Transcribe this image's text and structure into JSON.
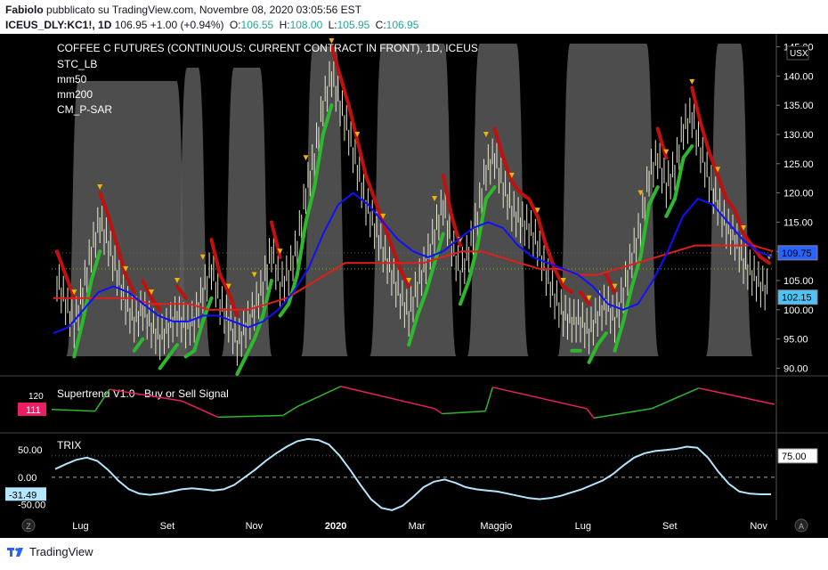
{
  "header": {
    "author": "Fabiolo",
    "published_text": "pubblicato su TradingView.com, Novembre 08, 2020 03:05:56 EST",
    "symbol": "ICEUS_DLY:KC1!, 1D",
    "last": "106.95",
    "change": "+1.00 (+0.94%)",
    "open_label": "O:",
    "open": "106.55",
    "high_label": "H:",
    "high": "108.00",
    "low_label": "L:",
    "low": "105.95",
    "close_label": "C:",
    "close": "106.95"
  },
  "footer": {
    "brand": "TradingView"
  },
  "chart_data": [
    {
      "type": "line",
      "title": "COFFEE C FUTURES (CONTINUOUS: CURRENT CONTRACT IN FRONT), 1D, ICEUS",
      "indicators": [
        "STC_LB",
        "mm50",
        "mm200",
        "CM_P-SAR"
      ],
      "currency": "USX",
      "x_ticks": [
        "Lug",
        "Set",
        "Nov",
        "2020",
        "Mar",
        "Maggio",
        "Lug",
        "Set",
        "Nov"
      ],
      "y_ticks": [
        90,
        95,
        100,
        105,
        110,
        115,
        120,
        125,
        130,
        135,
        140,
        145
      ],
      "ylim": [
        89,
        146
      ],
      "price_labels": [
        {
          "value": 75.0,
          "text": "75.00",
          "color": "#ffffff"
        },
        {
          "value": 109.75,
          "text": "109.75",
          "color": "#2962ff"
        },
        {
          "value": 102.15,
          "text": "102.15",
          "color": "#4fc3f7"
        }
      ],
      "colors": {
        "mm50": "#1010ff",
        "mm200": "#e0201a",
        "trend_up": "#2eb82e",
        "trend_down": "#c0110f",
        "sar": "#f0b400",
        "stc": "#5a5a5a"
      },
      "series": [
        {
          "name": "price",
          "values": [
            105,
            101,
            97,
            103,
            110,
            115,
            111,
            106,
            101,
            98,
            100,
            97,
            95,
            97,
            99,
            97,
            98,
            103,
            107,
            101,
            98,
            94,
            97,
            100,
            104,
            110,
            104,
            106,
            111,
            120,
            126,
            135,
            140,
            135,
            130,
            124,
            118,
            114,
            110,
            106,
            102,
            99,
            104,
            108,
            113,
            118,
            111,
            106,
            110,
            116,
            124,
            126,
            121,
            117,
            115,
            114,
            111,
            106,
            102,
            99,
            98,
            98,
            96,
            99,
            101,
            98,
            103,
            109,
            114,
            123,
            126,
            121,
            124,
            131,
            133,
            127,
            122,
            118,
            114,
            112,
            108,
            106,
            104,
            103
          ],
          "x_start": "2019-06-01",
          "x_end": "2020-11-06"
        },
        {
          "name": "mm50",
          "values": [
            96,
            97,
            100,
            103,
            104,
            103,
            101,
            99,
            98,
            98,
            99,
            99,
            98,
            97,
            98,
            100,
            103,
            107,
            113,
            118,
            120,
            118,
            115,
            112,
            110,
            109,
            110,
            112,
            114,
            115,
            114,
            111,
            109,
            108,
            107,
            106,
            104,
            101,
            100,
            101,
            105,
            110,
            116,
            119,
            118,
            115,
            112,
            110,
            109
          ]
        },
        {
          "name": "mm200",
          "values": [
            102,
            102,
            102,
            102,
            102,
            101,
            101,
            101,
            100,
            100,
            100,
            101,
            102,
            104,
            106,
            108,
            108,
            108,
            108,
            108,
            109,
            110,
            110,
            109,
            108,
            107,
            107,
            106,
            106,
            107,
            108,
            109,
            110,
            111,
            111,
            111,
            111,
            110
          ]
        }
      ]
    },
    {
      "type": "line",
      "title": "Supertrend V1.0 - Buy or Sell Signal",
      "y_ticks": [
        120
      ],
      "current": "111",
      "current_color": "#e91e63"
    },
    {
      "type": "line",
      "title": "TRIX",
      "y_ticks": [
        50,
        0,
        -50
      ],
      "y_tick_labels": [
        "50.00",
        "0.00",
        "-50.00"
      ],
      "current": "-31.49",
      "ylim": [
        -62,
        78
      ],
      "values": [
        15,
        24,
        32,
        36,
        30,
        14,
        -6,
        -22,
        -30,
        -32,
        -30,
        -26,
        -22,
        -20,
        -22,
        -24,
        -22,
        -14,
        0,
        14,
        30,
        44,
        56,
        66,
        70,
        68,
        60,
        40,
        14,
        -14,
        -40,
        -56,
        -60,
        -52,
        -36,
        -18,
        -8,
        -4,
        -10,
        -18,
        -22,
        -24,
        -26,
        -30,
        -34,
        -38,
        -40,
        -38,
        -34,
        -28,
        -22,
        -14,
        -6,
        6,
        22,
        36,
        44,
        48,
        50,
        52,
        56,
        54,
        36,
        10,
        -12,
        -26,
        -30,
        -31,
        -31
      ]
    }
  ]
}
